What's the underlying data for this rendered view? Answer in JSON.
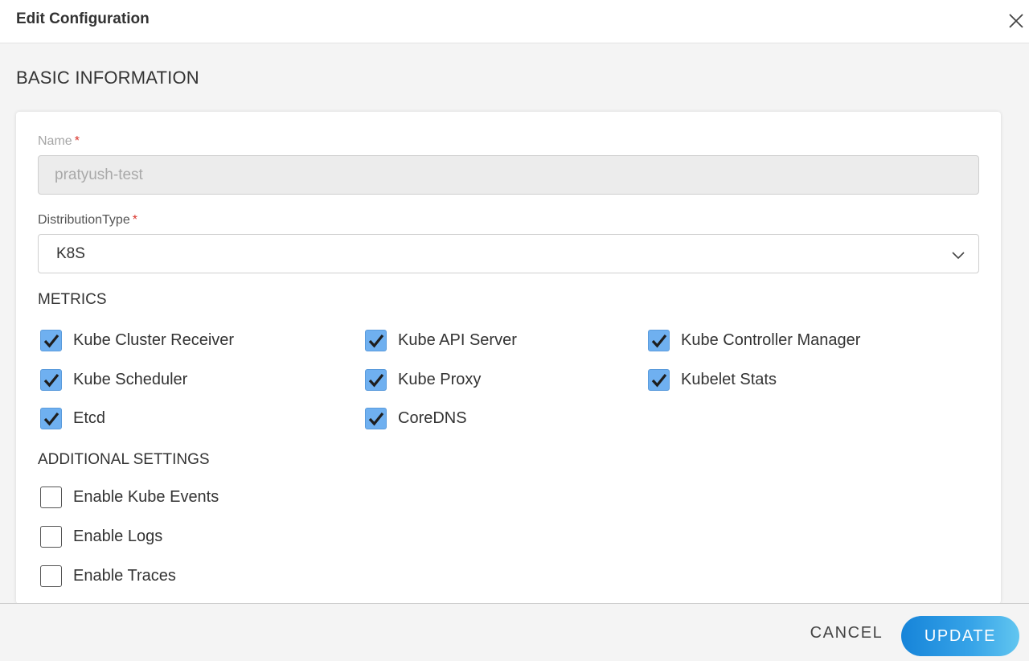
{
  "header": {
    "title": "Edit Configuration",
    "close_icon": "close-icon"
  },
  "basic": {
    "section_title": "BASIC INFORMATION",
    "name_label": "Name",
    "name_value": "pratyush-test",
    "required_mark": "*",
    "distribution_label": "DistributionType",
    "distribution_value": "K8S"
  },
  "metrics": {
    "title": "METRICS",
    "items": [
      {
        "label": "Kube Cluster Receiver",
        "checked": true
      },
      {
        "label": "Kube API Server",
        "checked": true
      },
      {
        "label": "Kube Controller Manager",
        "checked": true
      },
      {
        "label": "Kube Scheduler",
        "checked": true
      },
      {
        "label": "Kube Proxy",
        "checked": true
      },
      {
        "label": "Kubelet Stats",
        "checked": true
      },
      {
        "label": "Etcd",
        "checked": true
      },
      {
        "label": "CoreDNS",
        "checked": true
      }
    ]
  },
  "additional": {
    "title": "ADDITIONAL SETTINGS",
    "items": [
      {
        "label": "Enable Kube Events",
        "checked": false
      },
      {
        "label": "Enable Logs",
        "checked": false
      },
      {
        "label": "Enable Traces",
        "checked": false
      }
    ]
  },
  "footer": {
    "cancel_label": "CANCEL",
    "update_label": "UPDATE"
  },
  "colors": {
    "checkbox_checked": "#6fb0f0",
    "primary_button": "#1684d9",
    "required": "#d9342b"
  }
}
